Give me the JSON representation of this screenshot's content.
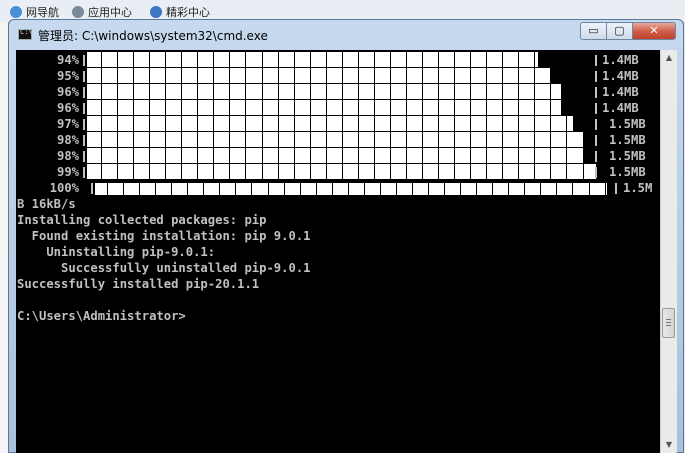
{
  "background": {
    "bookmarks": [
      {
        "label": "网导航",
        "icon": "globe-icon",
        "color": "#4a90d9"
      },
      {
        "label": "应用中心",
        "icon": "globe-icon",
        "color": "#7a8a9a"
      },
      {
        "label": "精彩中心",
        "icon": "circle-icon",
        "color": "#3b78c2"
      }
    ]
  },
  "window": {
    "title": "管理员: C:\\windows\\system32\\cmd.exe",
    "minimize_symbol": "▭",
    "maximize_symbol": "▢",
    "close_symbol": "✕"
  },
  "console": {
    "progress_rows": [
      {
        "percent_label": "94%",
        "fraction": 0.94,
        "size": "1.4MB"
      },
      {
        "percent_label": "95%",
        "fraction": 0.95,
        "size": "1.4MB"
      },
      {
        "percent_label": "96%",
        "fraction": 0.96,
        "size": "1.4MB"
      },
      {
        "percent_label": "96%",
        "fraction": 0.96,
        "size": "1.4MB"
      },
      {
        "percent_label": "97%",
        "fraction": 0.97,
        "size": "1.5MB"
      },
      {
        "percent_label": "98%",
        "fraction": 0.98,
        "size": "1.5MB"
      },
      {
        "percent_label": "98%",
        "fraction": 0.98,
        "size": "1.5MB"
      },
      {
        "percent_label": "99%",
        "fraction": 0.99,
        "size": "1.5MB"
      },
      {
        "percent_label": "100%",
        "fraction": 1.0,
        "size": "1.5M"
      }
    ],
    "lines": [
      "B 16kB/s",
      "Installing collected packages: pip",
      "  Found existing installation: pip 9.0.1",
      "    Uninstalling pip-9.0.1:",
      "      Successfully uninstalled pip-9.0.1",
      "Successfully installed pip-20.1.1",
      "",
      "C:\\Users\\Administrator>"
    ]
  },
  "colors": {
    "console_bg": "#000000",
    "console_text": "#c0c0c0",
    "close_button": "#c0432b"
  }
}
